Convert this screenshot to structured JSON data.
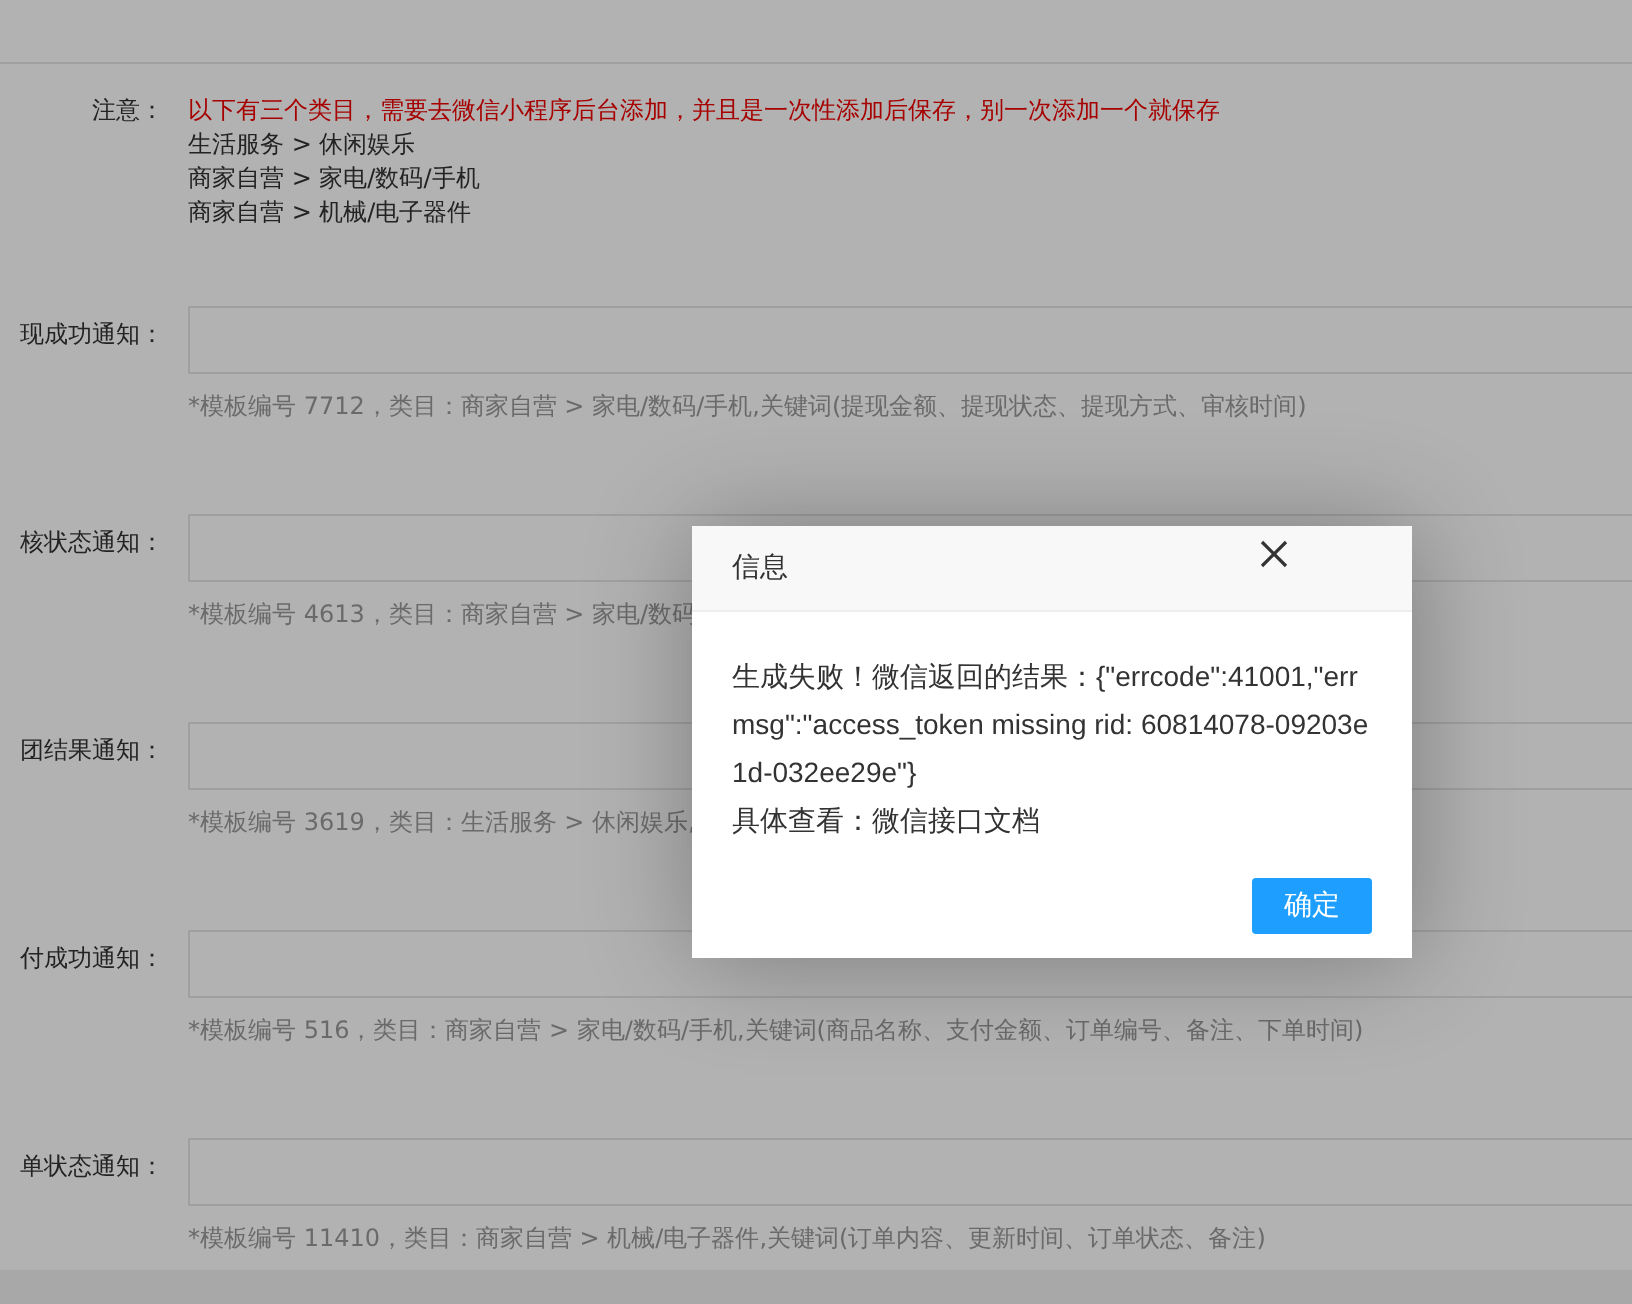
{
  "notice": {
    "label": "注意：",
    "warning": "以下有三个类目，需要去微信小程序后台添加，并且是一次性添加后保存，别一次添加一个就保存",
    "lines": [
      "生活服务 > 休闲娱乐",
      "商家自营 > 家电/数码/手机",
      "商家自营 > 机械/电子器件"
    ]
  },
  "fields": [
    {
      "label": "现成功通知：",
      "hint": "*模板编号 7712，类目：商家自营 > 家电/数码/手机,关键词(提现金额、提现状态、提现方式、审核时间)"
    },
    {
      "label": "核状态通知：",
      "hint": "*模板编号 4613，类目：商家自营 > 家电/数码"
    },
    {
      "label": "团结果通知：",
      "hint": "*模板编号 3619，类目：生活服务 > 休闲娱乐,"
    },
    {
      "label": "付成功通知：",
      "hint": "*模板编号 516，类目：商家自营 > 家电/数码/手机,关键词(商品名称、支付金额、订单编号、备注、下单时间)"
    },
    {
      "label": "单状态通知：",
      "hint": "*模板编号 11410，类目：商家自营 > 机械/电子器件,关键词(订单内容、更新时间、订单状态、备注)"
    }
  ],
  "dialog": {
    "title": "信息",
    "message": "生成失败！微信返回的结果：{\"errcode\":41001,\"errmsg\":\"access_token missing rid: 60814078-09203e1d-032ee29e\"}",
    "detail": "具体查看：微信接口文档",
    "button": "确定"
  }
}
